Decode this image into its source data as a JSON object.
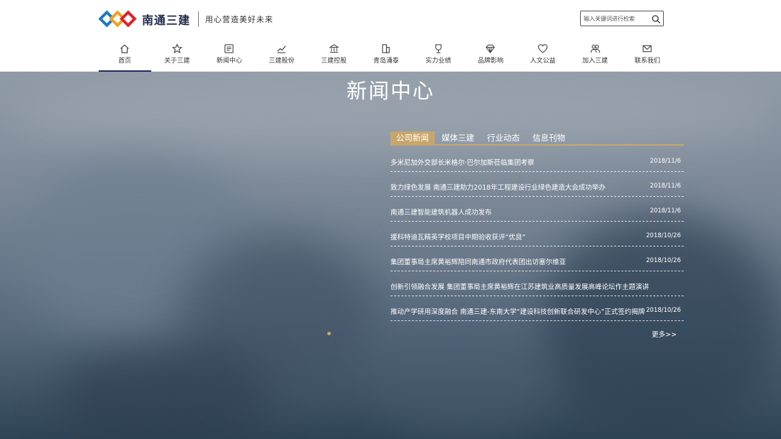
{
  "brand": {
    "name": "南通三建",
    "slogan": "用心营造美好未来"
  },
  "search": {
    "placeholder": "输入关键词进行检索"
  },
  "nav": [
    {
      "label": "首页",
      "icon": "home-icon"
    },
    {
      "label": "关于三建",
      "icon": "star-icon"
    },
    {
      "label": "新闻中心",
      "icon": "newspaper-icon"
    },
    {
      "label": "三建股份",
      "icon": "trend-icon"
    },
    {
      "label": "三建控股",
      "icon": "bank-icon"
    },
    {
      "label": "青岛涌泰",
      "icon": "building-icon"
    },
    {
      "label": "实力业绩",
      "icon": "trophy-icon"
    },
    {
      "label": "品牌影响",
      "icon": "diamond-icon"
    },
    {
      "label": "人文公益",
      "icon": "heart-icon"
    },
    {
      "label": "加入三建",
      "icon": "people-icon"
    },
    {
      "label": "联系我们",
      "icon": "mail-icon"
    }
  ],
  "hero": {
    "title": "新闻中心"
  },
  "tabs": [
    "公司新闻",
    "媒体三建",
    "行业动态",
    "信息刊物"
  ],
  "news": [
    {
      "title": "多米尼加外交部长米格尔·巴尔加斯莅临集团考察",
      "date": "2018/11/6"
    },
    {
      "title": "致力绿色发展 南通三建助力2018年工程建设行业绿色建造大会成功举办",
      "date": "2018/11/6"
    },
    {
      "title": "南通三建智能建筑机器人成功发布",
      "date": "2018/11/6"
    },
    {
      "title": "援科特迪瓦精英学校项目中期验收获评“优良”",
      "date": "2018/10/26"
    },
    {
      "title": "集团董事局主席黄裕辉陪同南通市政府代表团出访塞尔维亚",
      "date": "2018/10/26"
    },
    {
      "title": "创新引领融合发展 集团董事局主席黄裕辉在江苏建筑业高质量发展高峰论坛作主题演讲",
      "date": ""
    },
    {
      "title": "推动产学研用深度融合 南通三建-东南大学“建设科技创新联合研发中心”正式签约揭牌",
      "date": "2018/10/26"
    }
  ],
  "more": {
    "label": "更多>>"
  },
  "colors": {
    "accent": "#c8a66b",
    "nav_active": "#1f2a5a",
    "logo_blue": "#1b78c8",
    "logo_orange": "#f3a01b",
    "logo_red": "#e3202a"
  }
}
